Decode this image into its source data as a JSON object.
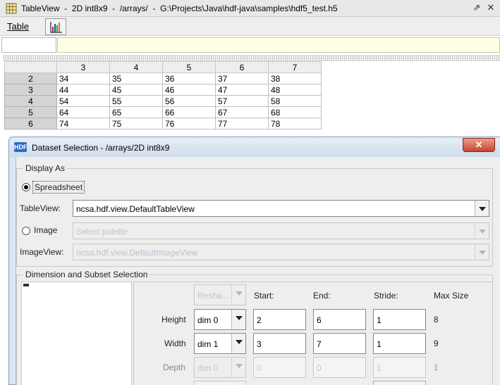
{
  "frame": {
    "title": "TableView  -  2D int8x9  -  /arrays/  -  G:\\Projects\\Java\\hdf-java\\samples\\hdf5_test.h5"
  },
  "menu": {
    "table": "Table"
  },
  "sheet": {
    "columns": [
      "3",
      "4",
      "5",
      "6",
      "7"
    ],
    "rows": [
      {
        "header": "2",
        "cells": [
          "34",
          "35",
          "36",
          "37",
          "38"
        ]
      },
      {
        "header": "3",
        "cells": [
          "44",
          "45",
          "46",
          "47",
          "48"
        ]
      },
      {
        "header": "4",
        "cells": [
          "54",
          "55",
          "56",
          "57",
          "58"
        ]
      },
      {
        "header": "5",
        "cells": [
          "64",
          "65",
          "66",
          "67",
          "68"
        ]
      },
      {
        "header": "6",
        "cells": [
          "74",
          "75",
          "76",
          "77",
          "78"
        ]
      }
    ]
  },
  "dialog": {
    "icon_text": "HDF",
    "title": "Dataset Selection - /arrays/2D int8x9",
    "display_as": {
      "group_title": "Display As",
      "spreadsheet_label": "Spreadsheet",
      "tableview_label": "TableView:",
      "tableview_value": "ncsa.hdf.view.DefaultTableView",
      "image_label": "Image",
      "palette_value": "Select palette",
      "imageview_label": "ImageView:",
      "imageview_value": "ncsa.hdf.view.DefaultImageView"
    },
    "dimension": {
      "group_title": "Dimension and Subset Selection",
      "reshape_value": "Resha...",
      "headers": {
        "start": "Start:",
        "end": "End:",
        "stride": "Stride:",
        "max": "Max Size"
      },
      "rows": [
        {
          "label": "Height",
          "dim": "dim 0",
          "start": "2",
          "end": "6",
          "stride": "1",
          "max": "8",
          "enabled": true
        },
        {
          "label": "Width",
          "dim": "dim 1",
          "start": "3",
          "end": "7",
          "stride": "1",
          "max": "9",
          "enabled": true
        },
        {
          "label": "Depth",
          "dim": "dim 0",
          "start": "0",
          "end": "0",
          "stride": "1",
          "max": "1",
          "enabled": false
        }
      ]
    }
  }
}
